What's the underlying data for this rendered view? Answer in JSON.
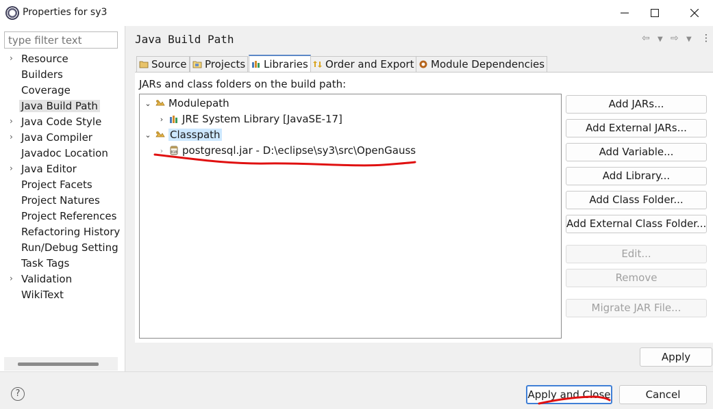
{
  "window": {
    "title": "Properties for sy3",
    "minimize": "—",
    "maximize": "☐",
    "close": "✕"
  },
  "sidebar": {
    "filter_placeholder": "type filter text",
    "items": [
      {
        "label": "Resource",
        "expandable": true
      },
      {
        "label": "Builders",
        "expandable": false
      },
      {
        "label": "Coverage",
        "expandable": false
      },
      {
        "label": "Java Build Path",
        "expandable": false,
        "selected": true
      },
      {
        "label": "Java Code Style",
        "expandable": true
      },
      {
        "label": "Java Compiler",
        "expandable": true
      },
      {
        "label": "Javadoc Location",
        "expandable": false
      },
      {
        "label": "Java Editor",
        "expandable": true
      },
      {
        "label": "Project Facets",
        "expandable": false
      },
      {
        "label": "Project Natures",
        "expandable": false
      },
      {
        "label": "Project References",
        "expandable": false
      },
      {
        "label": "Refactoring History",
        "expandable": false
      },
      {
        "label": "Run/Debug Setting",
        "expandable": false
      },
      {
        "label": "Task Tags",
        "expandable": false
      },
      {
        "label": "Validation",
        "expandable": true
      },
      {
        "label": "WikiText",
        "expandable": false
      }
    ]
  },
  "main": {
    "title": "Java Build Path",
    "tabs": [
      {
        "label": "Source",
        "icon": "source-folder-icon"
      },
      {
        "label": "Projects",
        "icon": "projects-icon"
      },
      {
        "label": "Libraries",
        "icon": "library-icon",
        "active": true
      },
      {
        "label": "Order and Export",
        "icon": "order-export-icon"
      },
      {
        "label": "Module Dependencies",
        "icon": "module-icon"
      }
    ],
    "panel_label": "JARs and class folders on the build path:",
    "tree": {
      "modulepath": "Modulepath",
      "jre": "JRE System Library [JavaSE-17]",
      "classpath": "Classpath",
      "jar": "postgresql.jar - D:\\eclipse\\sy3\\src\\OpenGauss"
    },
    "buttons": {
      "add_jars": "Add JARs...",
      "add_external_jars": "Add External JARs...",
      "add_variable": "Add Variable...",
      "add_library": "Add Library...",
      "add_class_folder": "Add Class Folder...",
      "add_external_class_folder": "Add External Class Folder...",
      "edit": "Edit...",
      "remove": "Remove",
      "migrate": "Migrate JAR File..."
    },
    "apply": "Apply"
  },
  "footer": {
    "help": "?",
    "apply_and_close": "Apply and Close",
    "cancel": "Cancel"
  },
  "colors": {
    "selection": "#cde8ff",
    "default_button_border": "#3f7fd6",
    "annotation_red": "#e01010"
  }
}
